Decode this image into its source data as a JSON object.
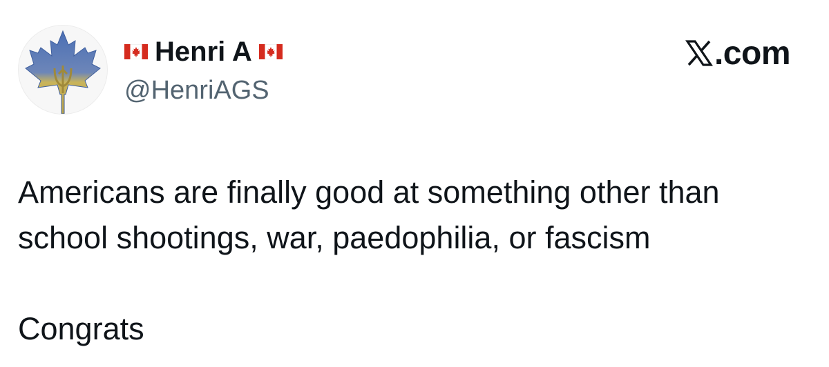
{
  "post": {
    "display_name": "Henri A",
    "handle": "@HenriAGS",
    "flag_icon": "canada-flag-icon",
    "avatar_icon": "maple-leaf-trident-icon",
    "text_lines": [
      "Americans are finally good at something other than",
      "school shootings, war, paedophilia, or fascism"
    ],
    "closing_line": "Congrats"
  },
  "brand": {
    "suffix": ".com",
    "icon": "x-logo-icon"
  },
  "colors": {
    "text": "#0f1419",
    "handle": "#536471",
    "flag_red": "#d52b1e",
    "avatar_blue": "#4a6fb5",
    "avatar_gold": "#c9b45a"
  }
}
